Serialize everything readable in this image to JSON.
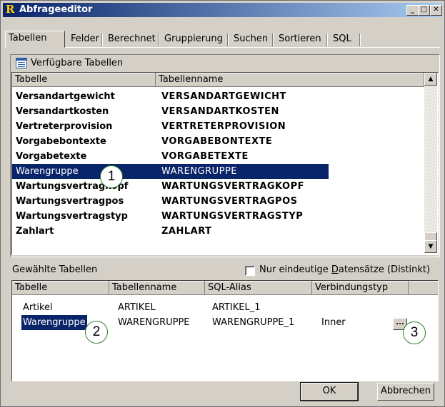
{
  "window": {
    "title": "Abfrageeditor",
    "app_icon_letter": "R"
  },
  "titlebar": {
    "minimize": "_",
    "maximize": "□",
    "close": "✕"
  },
  "tabs": [
    {
      "label": "Tabellen"
    },
    {
      "label": "Felder"
    },
    {
      "label": "Berechnet"
    },
    {
      "label": "Gruppierung"
    },
    {
      "label": "Suchen"
    },
    {
      "label": "Sortieren"
    },
    {
      "label": "SQL"
    }
  ],
  "available": {
    "title": "Verfügbare Tabellen",
    "icon": "table-grid-icon",
    "columns": [
      "Tabelle",
      "Tabellenname"
    ],
    "rows": [
      {
        "table": "Versandartgewicht",
        "name": "VERSANDARTGEWICHT"
      },
      {
        "table": "Versandartkosten",
        "name": "VERSANDARTKOSTEN"
      },
      {
        "table": "Vertreterprovision",
        "name": "VERTRETERPROVISION"
      },
      {
        "table": "Vorgabebontexte",
        "name": "VORGABEBONTEXTE"
      },
      {
        "table": "Vorgabetexte",
        "name": "VORGABETEXTE"
      },
      {
        "table": "Warengruppe",
        "name": "WARENGRUPPE",
        "selected": true
      },
      {
        "table": "Wartungsvertragkopf",
        "name": "WARTUNGSVERTRAGKOPF"
      },
      {
        "table": "Wartungsvertragpos",
        "name": "WARTUNGSVERTRAGPOS"
      },
      {
        "table": "Wartungsvertragstyp",
        "name": "WARTUNGSVERTRAGSTYP"
      },
      {
        "table": "Zahlart",
        "name": "ZAHLART"
      }
    ],
    "scroll_up": "▲",
    "scroll_down": "▼"
  },
  "selected": {
    "title": "Gewählte Tabellen",
    "distinct_label_pre": "Nur eindeutige ",
    "distinct_label_accel": "D",
    "distinct_label_post": "atensätze (Distinkt)",
    "distinct_checked": false,
    "columns": [
      "Tabelle",
      "Tabellenname",
      "SQL-Alias",
      "Verbindungstyp"
    ],
    "rows": [
      {
        "table": "Artikel",
        "name": "ARTIKEL",
        "alias": "ARTIKEL_1",
        "join": ""
      },
      {
        "table": "Warengruppe",
        "name": "WARENGRUPPE",
        "alias": "WARENGRUPPE_1",
        "join": "Inner"
      }
    ],
    "ellipsis": "..."
  },
  "markers": [
    "1",
    "2",
    "3"
  ],
  "buttons": {
    "ok": "OK",
    "cancel": "Abbrechen"
  },
  "colors": {
    "selection": "#0a246a",
    "dialog": "#d4d0c8",
    "marker_border": "#2f7d2f",
    "title_gradient_start": "#0a246a"
  }
}
